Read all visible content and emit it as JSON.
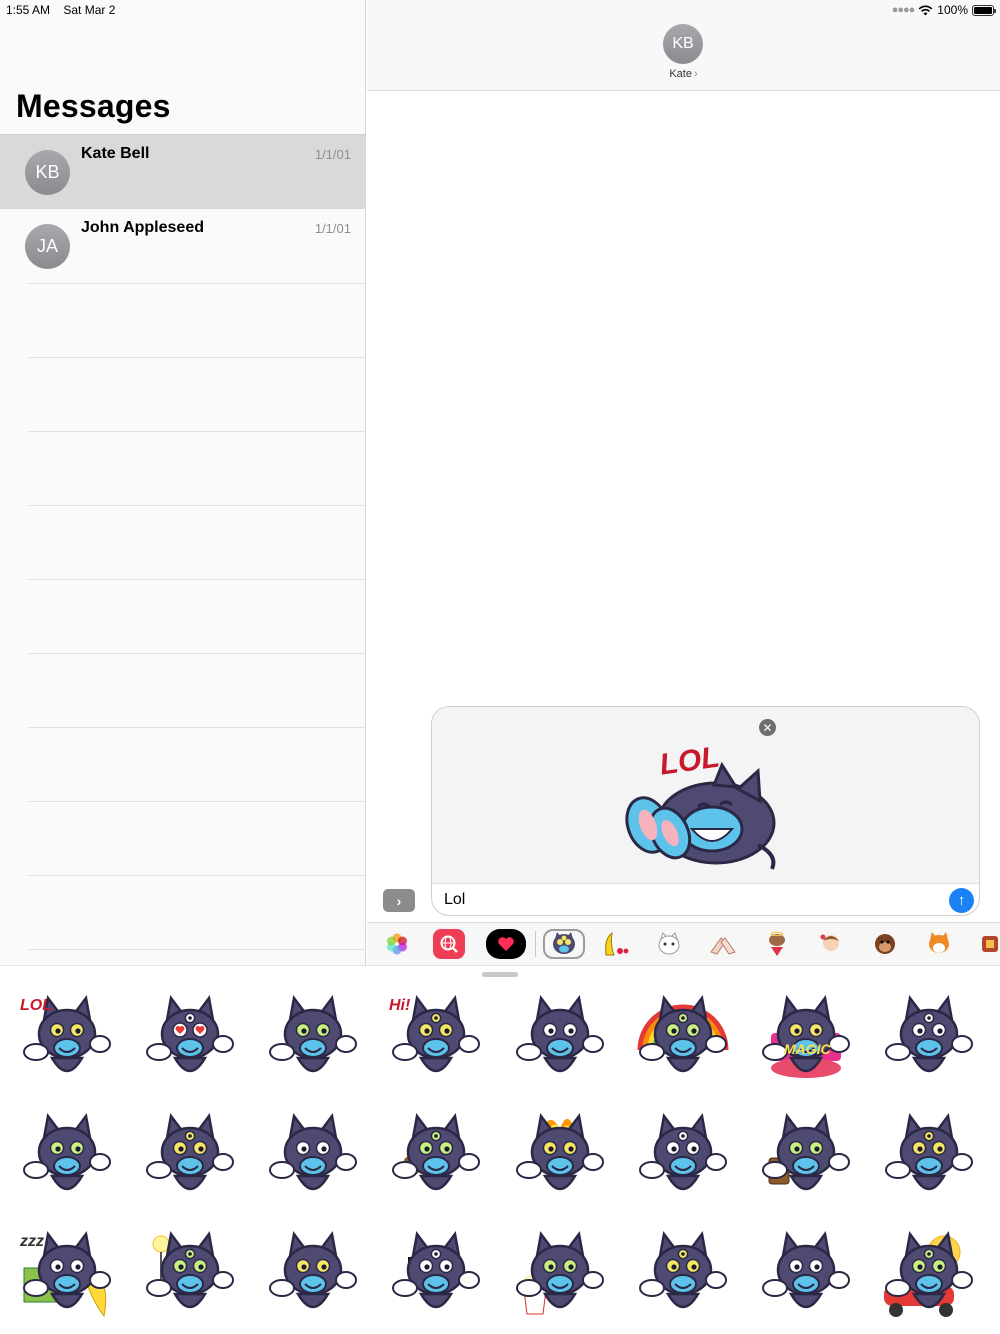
{
  "status_bar": {
    "time": "1:55 AM",
    "date": "Sat Mar 2",
    "battery": "100%"
  },
  "sidebar": {
    "title": "Messages",
    "conversations": [
      {
        "initials": "KB",
        "name": "Kate Bell",
        "date": "1/1/01",
        "selected": true
      },
      {
        "initials": "JA",
        "name": "John Appleseed",
        "date": "1/1/01",
        "selected": false
      }
    ]
  },
  "conversation": {
    "header_initials": "KB",
    "header_name": "Kate",
    "attachment_sticker": "lol-cat-sticker",
    "attachment_text": "LOL",
    "input_value": "Lol"
  },
  "app_drawer": {
    "apps": [
      "photos-icon",
      "web-search-icon",
      "digital-touch-icon",
      "cat-sticker-pack-icon",
      "banana-sticker-icon",
      "white-cat-sticker-icon",
      "hands-sticker-icon",
      "puppy-sticker-icon",
      "girl-sticker-icon",
      "monkey-sticker-icon",
      "fox-sticker-icon",
      "more-apps-icon"
    ],
    "selected": "cat-sticker-pack-icon"
  },
  "sticker_grid": {
    "stickers": [
      {
        "name": "lol-cat-sticker",
        "caption": "LOL"
      },
      {
        "name": "heart-eyes-cat-sticker",
        "caption": ""
      },
      {
        "name": "thumbs-up-cat-sticker",
        "caption": ""
      },
      {
        "name": "hi-cat-sticker",
        "caption": "Hi!"
      },
      {
        "name": "pointing-cat-sticker",
        "caption": ""
      },
      {
        "name": "rainbow-cat-sticker",
        "caption": ""
      },
      {
        "name": "magic-cat-sticker",
        "caption": "MAGIC"
      },
      {
        "name": "meditating-cat-sticker",
        "caption": ""
      },
      {
        "name": "kiss-cat-sticker",
        "caption": ""
      },
      {
        "name": "stop-cat-sticker",
        "caption": ""
      },
      {
        "name": "dab-cat-sticker",
        "caption": ""
      },
      {
        "name": "poop-cat-sticker",
        "caption": ""
      },
      {
        "name": "mind-blown-cat-sticker",
        "caption": ""
      },
      {
        "name": "eyes-popping-cat-sticker",
        "caption": ""
      },
      {
        "name": "coffee-cat-sticker",
        "caption": ""
      },
      {
        "name": "dizzy-cat-sticker",
        "caption": ""
      },
      {
        "name": "sleeping-cat-sticker",
        "caption": "zzz"
      },
      {
        "name": "idea-cat-sticker",
        "caption": ""
      },
      {
        "name": "sparkle-eyes-cat-sticker",
        "caption": ""
      },
      {
        "name": "3d-glasses-cat-sticker",
        "caption": ""
      },
      {
        "name": "popcorn-cat-sticker",
        "caption": ""
      },
      {
        "name": "facepalm-cat-sticker",
        "caption": ""
      },
      {
        "name": "shocked-cat-sticker",
        "caption": ""
      },
      {
        "name": "scooter-cat-sticker",
        "caption": ""
      }
    ]
  },
  "colors": {
    "accent_blue": "#1a82f5",
    "cat_purple": "#4e4a72",
    "cat_face": "#5ec3ea",
    "selection_gray": "#d9d9d9"
  }
}
